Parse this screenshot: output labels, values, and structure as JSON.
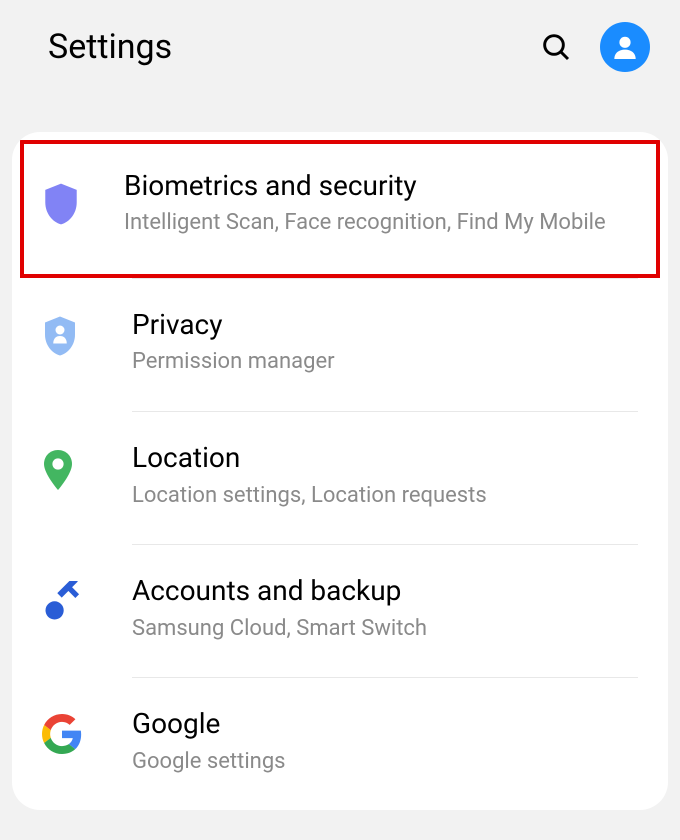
{
  "header": {
    "title": "Settings"
  },
  "items": [
    {
      "title": "Biometrics and security",
      "subtitle": "Intelligent Scan, Face recognition, Find My Mobile"
    },
    {
      "title": "Privacy",
      "subtitle": "Permission manager"
    },
    {
      "title": "Location",
      "subtitle": "Location settings, Location requests"
    },
    {
      "title": "Accounts and backup",
      "subtitle": "Samsung Cloud, Smart Switch"
    },
    {
      "title": "Google",
      "subtitle": "Google settings"
    }
  ]
}
